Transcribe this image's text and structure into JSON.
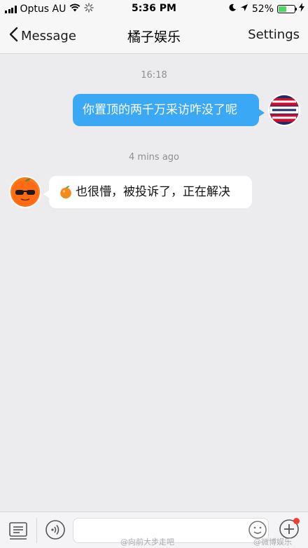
{
  "status_bar": {
    "carrier": "Optus AU",
    "time": "5:36 PM",
    "battery_percent": "52%",
    "battery_level": 0.52,
    "battery_color": "#4cd964"
  },
  "nav": {
    "back_label": "Message",
    "title": "橘子娱乐",
    "settings_label": "Settings"
  },
  "messages": [
    {
      "timestamp": "16:18",
      "direction": "sent",
      "text": "你置顶的两千万采访咋没了呢"
    },
    {
      "timestamp": "4 mins ago",
      "direction": "received",
      "text": "也很懵，被投诉了，正在解决"
    }
  ],
  "avatars": {
    "self_text_lines": [
      "网书院",
      "流行前沿",
      "福利专区"
    ]
  },
  "watermarks": [
    "@向前大步走吧",
    "@微博娱乐"
  ],
  "colors": {
    "sent_bubble": "#3aa8f4",
    "received_bubble": "#ffffff",
    "background": "#ececef",
    "notification_dot": "#f33b36"
  }
}
